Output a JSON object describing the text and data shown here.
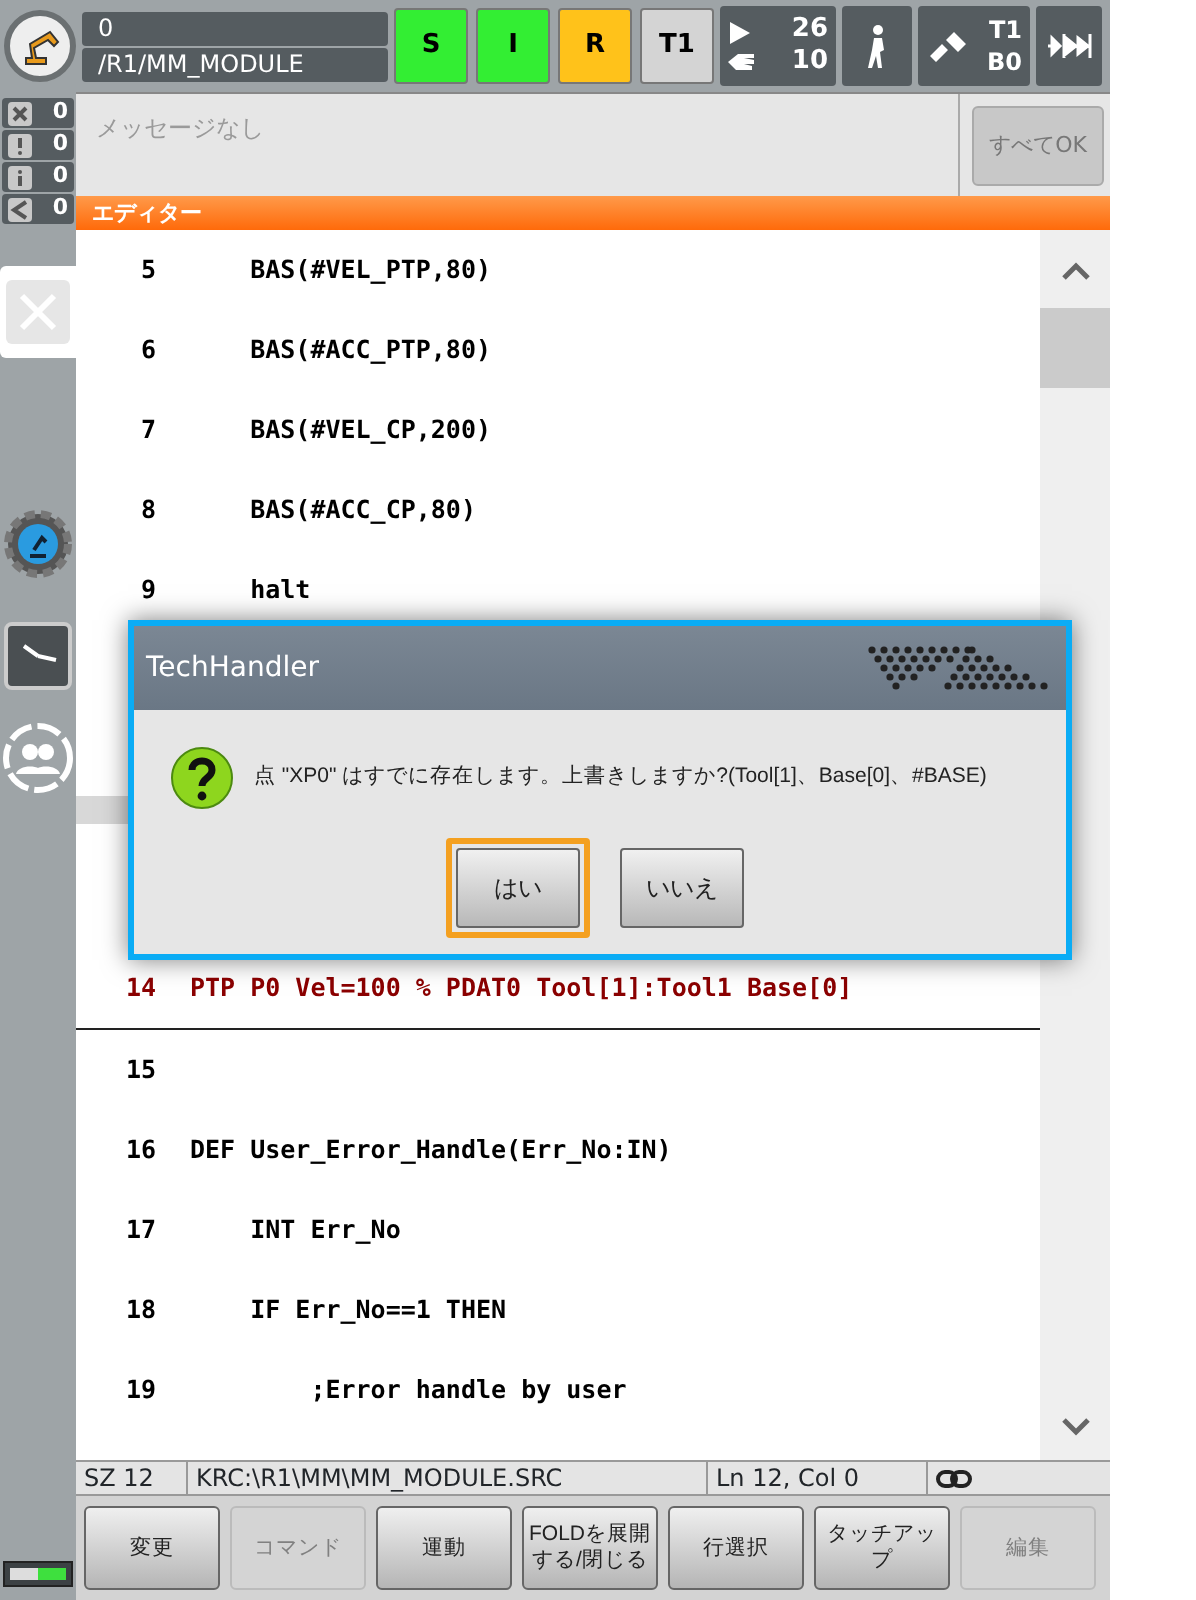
{
  "top_bar": {
    "program_counter": "0",
    "program_path": "/R1/MM_MODULE",
    "status_buttons": [
      {
        "label": "S",
        "color": "#33ee33"
      },
      {
        "label": "I",
        "color": "#33ee33"
      },
      {
        "label": "R",
        "color": "#ffc21a"
      },
      {
        "label": "T1",
        "color": "#d4d4d4"
      }
    ],
    "override": {
      "program": "26",
      "jog": "10"
    },
    "tool": "T1",
    "base": "B0"
  },
  "message_counters": [
    {
      "kind": "error",
      "count": "0"
    },
    {
      "kind": "warning",
      "count": "0"
    },
    {
      "kind": "info",
      "count": "0"
    },
    {
      "kind": "wait",
      "count": "0"
    }
  ],
  "message_window": {
    "text": "メッセージなし",
    "ok_all_button": {
      "label": "すべてOK",
      "disabled": true
    }
  },
  "editor": {
    "title": "エディター",
    "lines_above": [
      {
        "number": "5",
        "code": "    BAS(#VEL_PTP,80)",
        "color": "#000000"
      },
      {
        "number": "6",
        "code": "    BAS(#ACC_PTP,80)",
        "color": "#000000"
      },
      {
        "number": "7",
        "code": "    BAS(#VEL_CP,200)",
        "color": "#000000"
      },
      {
        "number": "8",
        "code": "    BAS(#ACC_CP,80)",
        "color": "#000000"
      },
      {
        "number": "9",
        "code": "    halt",
        "color": "#000000"
      }
    ],
    "lines_below": [
      {
        "number": "14",
        "code": "PTP P0 Vel=100 % PDAT0 Tool[1]:Tool1 Base[0]",
        "color": "#8b0000",
        "divider_after": true
      },
      {
        "number": "15",
        "color": "#000000",
        "divider_after": false
      },
      {
        "number": "16",
        "code": "DEF User_Error_Handle(Err_No:IN)",
        "color": "#000000",
        "divider_after": false
      },
      {
        "number": "17",
        "code": "    INT Err_No",
        "color": "#000000",
        "divider_after": false
      },
      {
        "number": "18",
        "code": "    IF Err_No==1 THEN",
        "color": "#000000",
        "divider_after": false
      },
      {
        "number": "19",
        "code": "        ;Error handle by user",
        "color": "#000000",
        "divider_after": false
      }
    ]
  },
  "dialog": {
    "title": "TechHandler",
    "message": "点 \"XP0\" はすでに存在します。上書きしますか?(Tool[1]、Base[0]、#BASE)",
    "buttons": [
      {
        "label": "はい",
        "focused": true
      },
      {
        "label": "いいえ",
        "focused": false
      }
    ]
  },
  "status_bar": {
    "size": "SZ 12",
    "file": "KRC:\\R1\\MM\\MM_MODULE.SRC",
    "position": "Ln 12, Col 0"
  },
  "softkeys": [
    {
      "label": "変更",
      "disabled": false
    },
    {
      "label": "コマンド",
      "disabled": true
    },
    {
      "label": "運動",
      "disabled": false
    },
    {
      "label": "FOLDを展開する/閉じる",
      "disabled": false
    },
    {
      "label": "行選択",
      "disabled": false
    },
    {
      "label": "タッチアップ",
      "disabled": false
    },
    {
      "label": "編集",
      "disabled": true
    }
  ]
}
